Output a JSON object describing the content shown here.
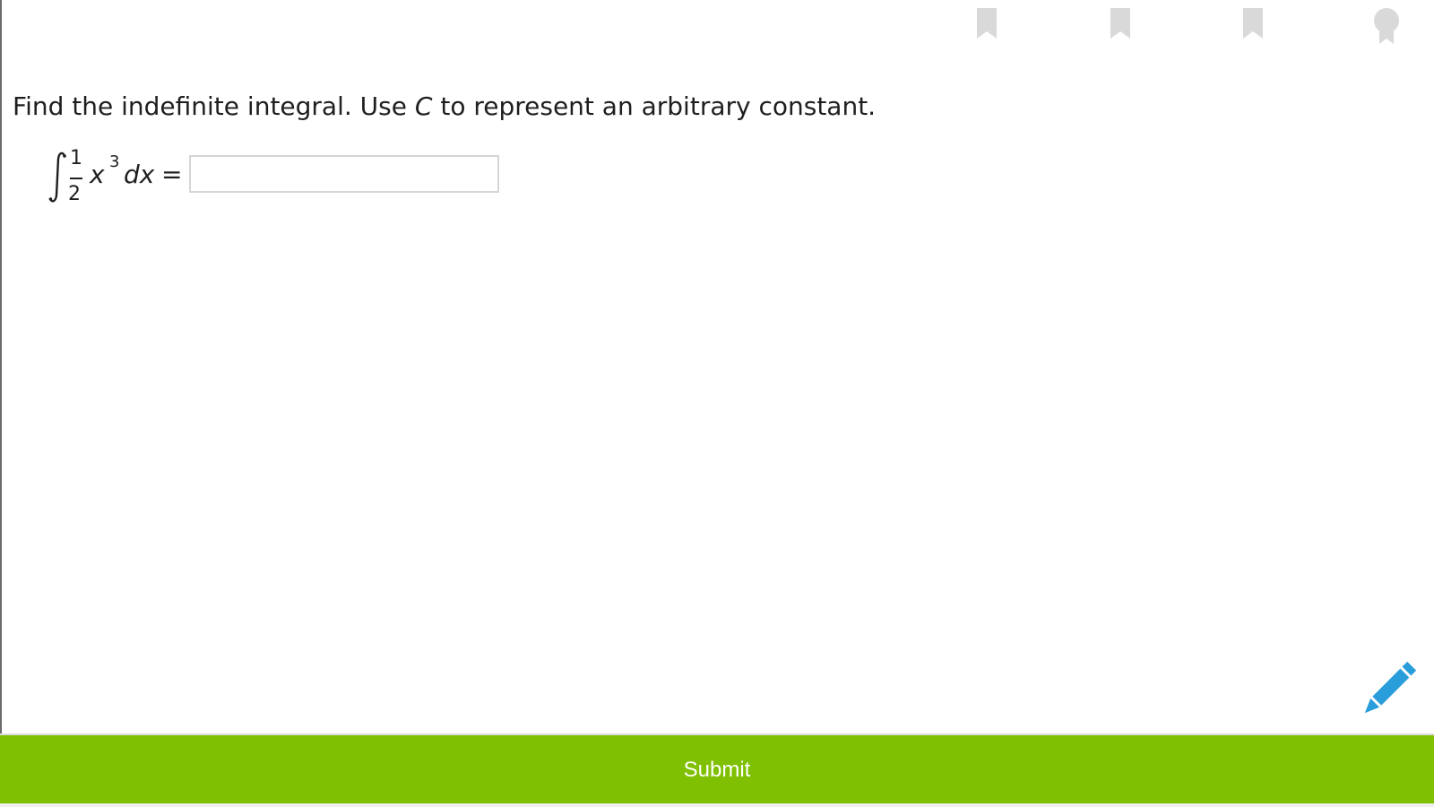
{
  "header": {
    "icons": [
      {
        "name": "bookmark-icon",
        "color": "#d9d9d9"
      },
      {
        "name": "bookmark-icon",
        "color": "#d9d9d9"
      },
      {
        "name": "bookmark-icon",
        "color": "#d9d9d9"
      },
      {
        "name": "award-ribbon-icon",
        "color": "#d9d9d9"
      }
    ]
  },
  "question": {
    "prompt_before": "Find the indefinite integral. Use ",
    "prompt_variable": "C",
    "prompt_after": " to represent an arbitrary constant.",
    "equation": {
      "integral_sign": "∫",
      "numerator": "1",
      "denominator": "2",
      "base": "x",
      "exponent": "3",
      "differential": "dx",
      "equals": "="
    },
    "answer_value": "",
    "answer_placeholder": ""
  },
  "tools": {
    "pencil_icon": "pencil-icon",
    "pencil_color": "#2a9ddb"
  },
  "footer": {
    "submit_label": "Submit",
    "submit_color": "#7fc002"
  }
}
